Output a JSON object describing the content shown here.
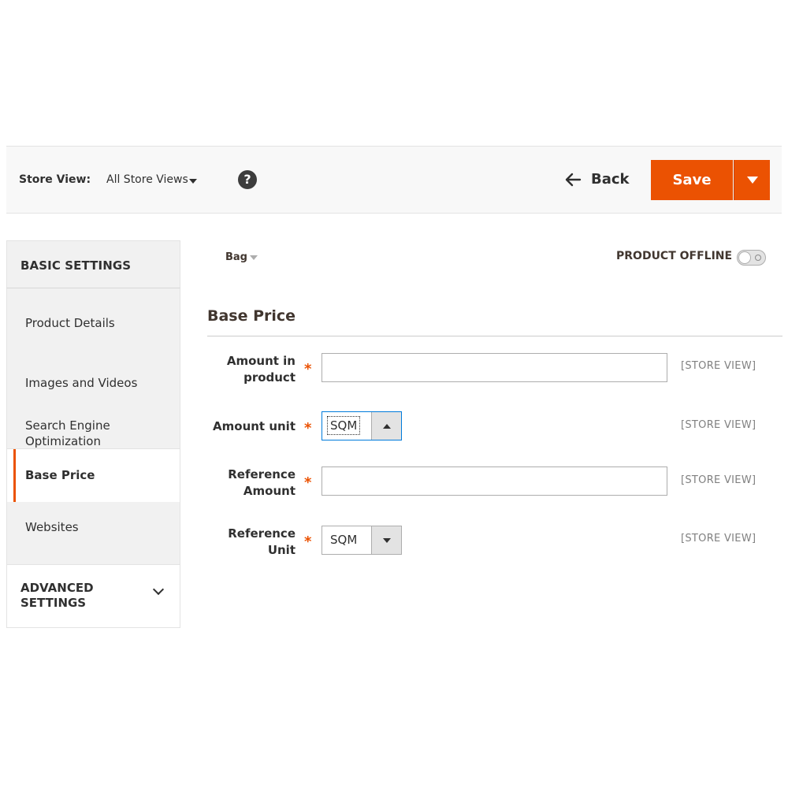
{
  "toolbar": {
    "store_view_label": "Store View:",
    "store_view_value": "All Store Views",
    "help_icon": "?",
    "back_label": "Back",
    "save_label": "Save",
    "accent_color": "#eb5202"
  },
  "sidebar": {
    "header": "BASIC SETTINGS",
    "items": [
      {
        "label": "Product Details"
      },
      {
        "label": "Images and Videos"
      },
      {
        "label": "Search Engine Optimization"
      },
      {
        "label": "Base Price",
        "active": true
      },
      {
        "label": "Websites"
      }
    ],
    "advanced": "ADVANCED SETTINGS"
  },
  "main": {
    "attribute_set": "Bag",
    "product_offline_label": "PRODUCT OFFLINE",
    "product_online": false,
    "section_title": "Base Price",
    "fields": [
      {
        "label_line1": "Amount in",
        "label_line2": "product",
        "type": "text",
        "value": "",
        "required": "*",
        "scope": "[STORE VIEW]"
      },
      {
        "label_line1": "Amount unit",
        "label_line2": "",
        "type": "select",
        "value": "SQM",
        "required": "*",
        "scope": "[STORE VIEW]"
      },
      {
        "label_line1": "Reference",
        "label_line2": "Amount",
        "type": "text",
        "value": "",
        "required": "*",
        "scope": "[STORE VIEW]"
      },
      {
        "label_line1": "Reference",
        "label_line2": "Unit",
        "type": "select",
        "value": "SQM",
        "required": "*",
        "scope": "[STORE VIEW]"
      }
    ]
  }
}
